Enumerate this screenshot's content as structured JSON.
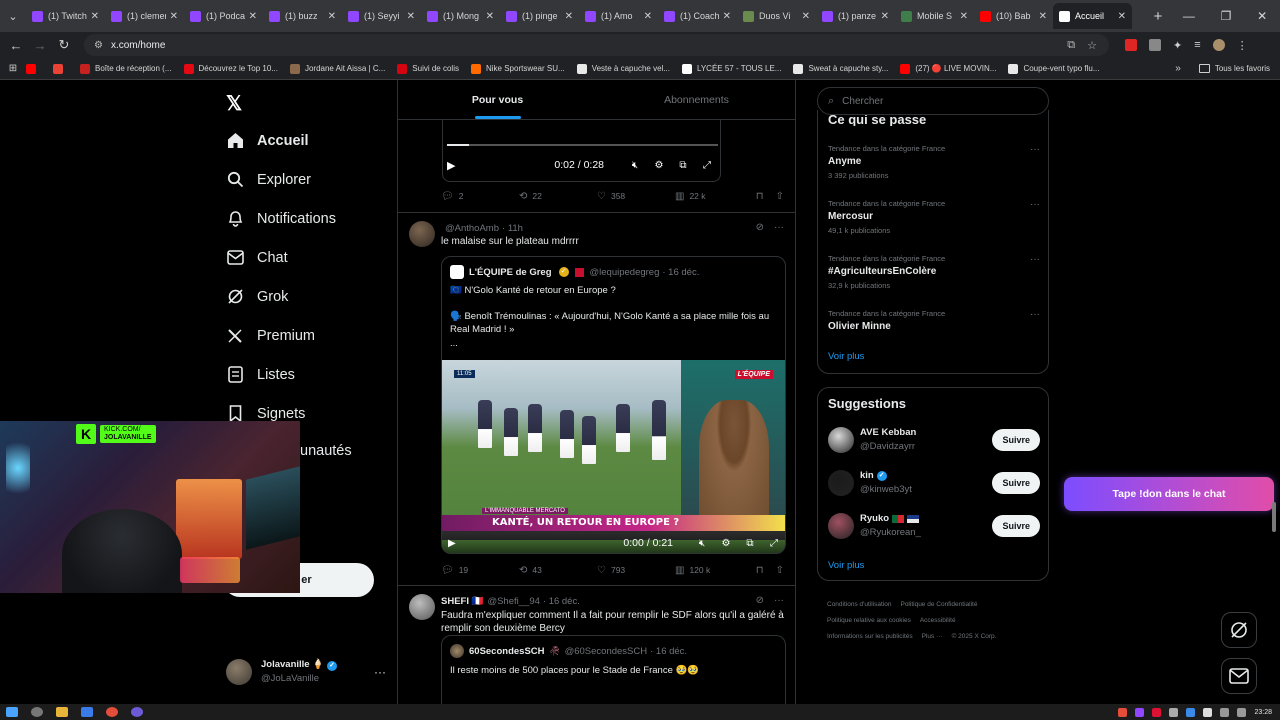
{
  "browser": {
    "tabs": [
      {
        "title": "(1) Twitch",
        "color": "#9146ff"
      },
      {
        "title": "(1) clemen",
        "color": "#9146ff"
      },
      {
        "title": "(1) Podcast",
        "color": "#9146ff"
      },
      {
        "title": "(1) buzz",
        "color": "#9146ff"
      },
      {
        "title": "(1) Seyyi",
        "color": "#9146ff"
      },
      {
        "title": "(1) Mong",
        "color": "#9146ff"
      },
      {
        "title": "(1) pinge",
        "color": "#9146ff"
      },
      {
        "title": "(1) Amo",
        "color": "#9146ff"
      },
      {
        "title": "(1) Coach",
        "color": "#9146ff"
      },
      {
        "title": "Duos Vi",
        "color": "#6b8a4e"
      },
      {
        "title": "(1) panze",
        "color": "#9146ff"
      },
      {
        "title": "Mobile S",
        "color": "#3f7e4a"
      },
      {
        "title": "(10) Bab",
        "color": "#ff0000"
      },
      {
        "title": "Accueil",
        "color": "#ffffff",
        "active": true
      }
    ],
    "url": "x.com/home",
    "bookmarks": [
      {
        "label": "",
        "color": "#ff0000"
      },
      {
        "label": "",
        "color": "#ea4335"
      },
      {
        "label": "Boîte de réception (...",
        "color": "#c5221f"
      },
      {
        "label": "Découvrez le Top 10...",
        "color": "#e50914"
      },
      {
        "label": "Jordane Ait Aissa | C...",
        "color": "#8a6a4a"
      },
      {
        "label": "Suivi de colis",
        "color": "#d40511"
      },
      {
        "label": "Nike Sportswear SU...",
        "color": "#ff6a00"
      },
      {
        "label": "Veste à capuche vel...",
        "color": "#e8e8e8"
      },
      {
        "label": "LYCÉE 57 - TOUS LE...",
        "color": "#ffffff"
      },
      {
        "label": "Sweat à capuche sty...",
        "color": "#e8e8e8"
      },
      {
        "label": "(27) 🔴 LIVE MOVIN...",
        "color": "#ff0000"
      },
      {
        "label": "Coupe-vent typo flu...",
        "color": "#e8e8e8"
      }
    ],
    "bookmarks_more": "»",
    "all_bookmarks": "Tous les favoris"
  },
  "nav": {
    "logo": "𝕏",
    "items": [
      {
        "label": "Accueil",
        "icon": "home-icon",
        "active": true
      },
      {
        "label": "Explorer",
        "icon": "search-icon"
      },
      {
        "label": "Notifications",
        "icon": "bell-icon"
      },
      {
        "label": "Chat",
        "icon": "mail-icon"
      },
      {
        "label": "Grok",
        "icon": "grok-icon"
      },
      {
        "label": "Premium",
        "icon": "x-premium-icon"
      },
      {
        "label": "Listes",
        "icon": "list-icon"
      },
      {
        "label": "Signets",
        "icon": "bookmark-icon"
      }
    ],
    "communities_fragment": "unautés",
    "post_fragment": "er"
  },
  "profile": {
    "name": "Jolavanille 🍦",
    "handle": "@JoLaVanille",
    "more": "···"
  },
  "webcam": {
    "kick_line1": "KICK.COM/",
    "kick_line2": "JOLAVANILLE"
  },
  "timeline": {
    "tabs": [
      "Pour vous",
      "Abonnements"
    ],
    "top_video": {
      "time": "0:02 / 0:28",
      "progress": 0.08
    },
    "top_actions": {
      "replies": "2",
      "reposts": "22",
      "likes": "358",
      "views": "22 k"
    },
    "post1": {
      "name": "",
      "handle": "@AnthoAmb",
      "time": "· 11h",
      "text": "le malaise sur le plateau mdrrrr",
      "quote": {
        "name": "L'ÉQUIPE de Greg",
        "handle": "@lequipedegreg",
        "time": "· 16 déc.",
        "line1": "🇪🇺 N'Golo Kanté de retour en Europe ?",
        "line2": "🗣️ Benoît Trémoulinas : « Aujourd'hui, N'Golo Kanté a sa place mille fois au Real Madrid ! »",
        "line3": "...",
        "video": {
          "banner": "KANTÉ, UN RETOUR EN EUROPE ?",
          "tag": "L'IMMANQUABLE MERCATO",
          "brand": "L'ÉQUIPE",
          "clock": "11:05",
          "time": "0:00 / 0:21"
        }
      },
      "actions": {
        "replies": "19",
        "reposts": "43",
        "likes": "793",
        "views": "120 k"
      }
    },
    "post2": {
      "name": "SHEFI 🇫🇷",
      "handle": "@Shefi__94",
      "time": "· 16 déc.",
      "text": "Faudra m'expliquer comment Il a fait pour remplir le SDF alors qu'il a galéré à remplir son deuxième Bercy",
      "quote": {
        "name": "60SecondesSCH",
        "handle": "@60SecondesSCH",
        "time": "· 16 déc.",
        "text": "Il reste moins de 500 places pour le Stade de France 🥹🥹"
      }
    }
  },
  "sidebar": {
    "search_placeholder": "Chercher",
    "trends_title": "Ce qui se passe",
    "trends": [
      {
        "category": "Tendance dans la catégorie France",
        "name": "Anyme",
        "posts": "3 392 publications"
      },
      {
        "category": "Tendance dans la catégorie France",
        "name": "Mercosur",
        "posts": "49,1 k publications"
      },
      {
        "category": "Tendance dans la catégorie France",
        "name": "#AgriculteursEnColère",
        "posts": "32,9 k publications"
      },
      {
        "category": "Tendance dans la catégorie France",
        "name": "Olivier Minne",
        "posts": ""
      }
    ],
    "trends_more": "Voir plus",
    "suggestions_title": "Suggestions",
    "suggestions": [
      {
        "name": "AVE Kebban",
        "handle": "@Davidzayrr",
        "follow": "Suivre",
        "color": "#d8d8d8"
      },
      {
        "name": "kin",
        "handle": "@kinweb3yt",
        "follow": "Suivre",
        "color": "#1b1b1b",
        "verified": true
      },
      {
        "name": "Ryuko",
        "handle": "@Ryukorean_",
        "follow": "Suivre",
        "color": "#a05060",
        "flags": true
      }
    ],
    "suggestions_more": "Voir plus",
    "footer": [
      "Conditions d'utilisation",
      "Politique de Confidentialité",
      "Politique relative aux cookies",
      "Accessibilité",
      "Informations sur les publicités",
      "Plus ···",
      "© 2025 X Corp."
    ]
  },
  "overlay": {
    "donate": "Tape !don dans le chat"
  },
  "taskbar": {
    "clock": "23:28"
  },
  "colors": {
    "accent": "#1d9bf0",
    "kick": "#53fc18"
  }
}
